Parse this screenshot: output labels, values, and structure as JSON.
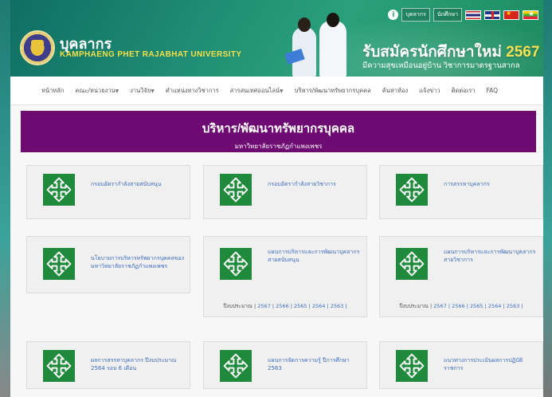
{
  "header": {
    "site_title": "บุคลากร",
    "site_subtitle": "KAMPHAENG PHET RAJABHAT UNIVERSITY",
    "topbar": {
      "personnel_label": "บุคลากร",
      "student_label": "นักศึกษา"
    },
    "banner": {
      "title": "รับสมัครนักศึกษาใหม่",
      "year": "2567",
      "subtitle": "มีความสุขเหมือนอยู่บ้าน วิชาการมาตรฐานสากล"
    }
  },
  "nav": {
    "items": [
      {
        "label": "หน้าหลัก",
        "dropdown": false
      },
      {
        "label": "คณะ/หน่วยงาน",
        "dropdown": true
      },
      {
        "label": "งานวิจัย",
        "dropdown": true
      },
      {
        "label": "ตำแหน่งทางวิชาการ",
        "dropdown": false
      },
      {
        "label": "สารสนเทศออนไลน์",
        "dropdown": true
      },
      {
        "label": "บริหาร/พัฒนาทรัพยากรบุคคล",
        "dropdown": false
      },
      {
        "label": "ค้นหาห้อง",
        "dropdown": false
      },
      {
        "label": "แจ้งข่าว",
        "dropdown": false
      },
      {
        "label": "ติดต่อเรา",
        "dropdown": false
      },
      {
        "label": "FAQ",
        "dropdown": false
      }
    ]
  },
  "hero": {
    "title": "บริหาร/พัฒนาทรัพยากรบุคคล",
    "subtitle": "มหาวิทยาลัยราชภัฏกำแพงเพชร"
  },
  "cards": {
    "c1": {
      "title": "กรอบอัตรากำลังสายสนับสนุน"
    },
    "c2": {
      "title": "กรอบอัตรากำลังสายวิชาการ"
    },
    "c3": {
      "title": "การสรรหาบุคลากร"
    },
    "c4": {
      "title": "นโยบายการบริหารทรัพยากรบุคคลของมหาวิทยาลัยราชภัฏกำแพงเพชร"
    },
    "c5": {
      "title": "แผนการบริหารและการพัฒนาบุคลากร สายสนับสนุน",
      "footer_label": "ปีงบประมาณ |",
      "footer_links": "2567 | 2566 | 2565 | 2564 | 2563 |"
    },
    "c6": {
      "title": "แผนการบริหารและการพัฒนาบุคลากร สายวิชาการ",
      "footer_label": "ปีงบประมาณ |",
      "footer_links": "2567 | 2566 | 2565 | 2564 | 2563 |"
    },
    "c7": {
      "title": "ผลการสรรหาบุคลากร ปีงบประมาณ 2564 รอบ 6 เดือน"
    },
    "c8": {
      "title": "แผนการจัดการความรู้ ปีการศึกษา 2563"
    },
    "c9": {
      "title": "แนวทางการประเมินผลการปฏิบัติราชการ"
    }
  },
  "colors": {
    "accent_green": "#208a3c",
    "hero_purple": "#6d0b72",
    "link_blue": "#3d6cbf",
    "banner_yellow": "#f4e04a"
  },
  "icons": {
    "card": "move-arrows-icon"
  }
}
